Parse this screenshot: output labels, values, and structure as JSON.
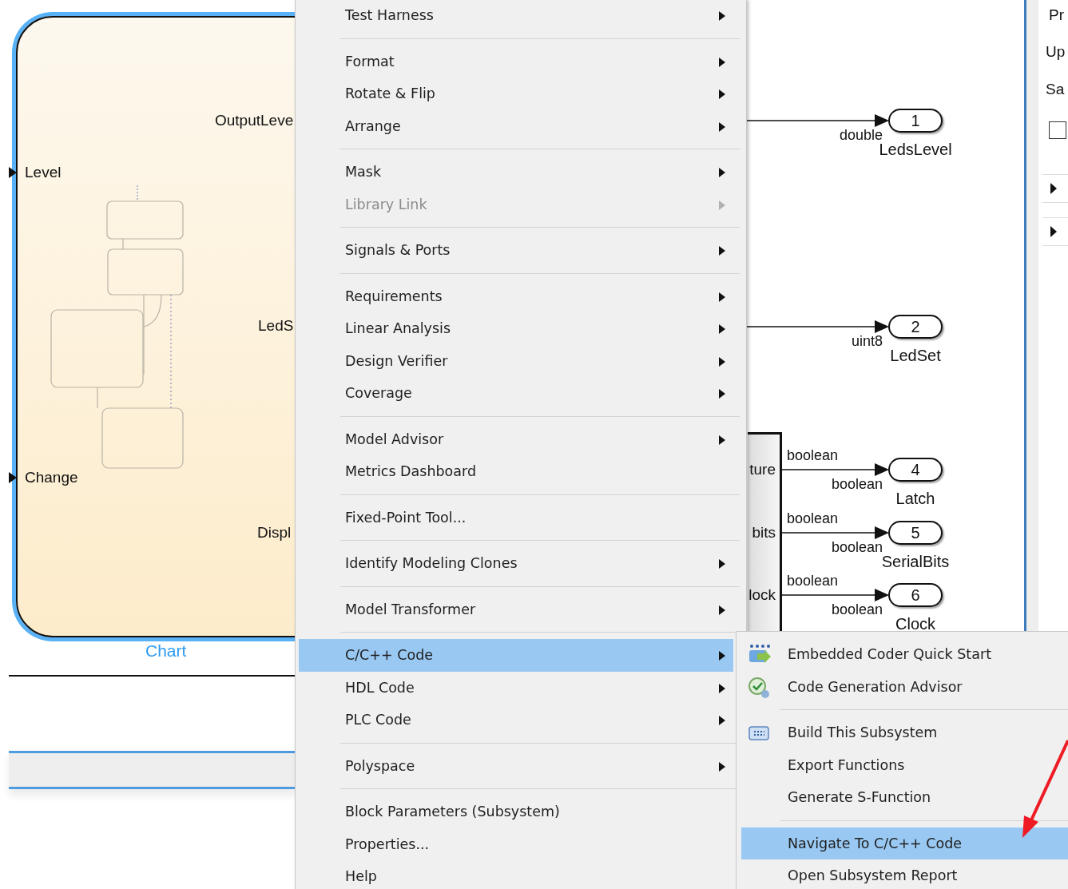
{
  "chart_block": {
    "title": "Chart",
    "inputs": [
      "Level",
      "Change"
    ],
    "outputs": [
      "OutputLeve",
      "LedS",
      "Displ"
    ]
  },
  "subsystem_block": {
    "ports": [
      "ture",
      "bits",
      "lock"
    ]
  },
  "outports": [
    {
      "number": "1",
      "name": "LedsLevel",
      "type_below": "double"
    },
    {
      "number": "2",
      "name": "LedSet",
      "type_below": "uint8"
    },
    {
      "number": "4",
      "name": "Latch",
      "type_above": "boolean",
      "type_below": "boolean"
    },
    {
      "number": "5",
      "name": "SerialBits",
      "type_above": "boolean",
      "type_below": "boolean"
    },
    {
      "number": "6",
      "name": "Clock",
      "type_above": "boolean",
      "type_below": "boolean"
    }
  ],
  "properties_panel": {
    "lines": [
      "Pr",
      "Up",
      "Sa"
    ],
    "checkbox": {
      "checked": false
    },
    "sections": [
      {
        "expanded": false
      },
      {
        "expanded": false
      }
    ]
  },
  "context_menu": {
    "items": [
      {
        "kind": "item",
        "label": "Test Harness",
        "submenu": true,
        "disabled": false,
        "selected": false
      },
      {
        "kind": "separator"
      },
      {
        "kind": "item",
        "label": "Format",
        "submenu": true,
        "disabled": false,
        "selected": false
      },
      {
        "kind": "item",
        "label": "Rotate & Flip",
        "submenu": true,
        "disabled": false,
        "selected": false
      },
      {
        "kind": "item",
        "label": "Arrange",
        "submenu": true,
        "disabled": false,
        "selected": false
      },
      {
        "kind": "separator"
      },
      {
        "kind": "item",
        "label": "Mask",
        "submenu": true,
        "disabled": false,
        "selected": false
      },
      {
        "kind": "item",
        "label": "Library Link",
        "submenu": true,
        "disabled": true,
        "selected": false
      },
      {
        "kind": "separator"
      },
      {
        "kind": "item",
        "label": "Signals & Ports",
        "submenu": true,
        "disabled": false,
        "selected": false
      },
      {
        "kind": "separator"
      },
      {
        "kind": "item",
        "label": "Requirements",
        "submenu": true,
        "disabled": false,
        "selected": false
      },
      {
        "kind": "item",
        "label": "Linear Analysis",
        "submenu": true,
        "disabled": false,
        "selected": false
      },
      {
        "kind": "item",
        "label": "Design Verifier",
        "submenu": true,
        "disabled": false,
        "selected": false
      },
      {
        "kind": "item",
        "label": "Coverage",
        "submenu": true,
        "disabled": false,
        "selected": false
      },
      {
        "kind": "separator"
      },
      {
        "kind": "item",
        "label": "Model Advisor",
        "submenu": true,
        "disabled": false,
        "selected": false
      },
      {
        "kind": "item",
        "label": "Metrics Dashboard",
        "submenu": false,
        "disabled": false,
        "selected": false
      },
      {
        "kind": "separator"
      },
      {
        "kind": "item",
        "label": "Fixed-Point Tool...",
        "submenu": false,
        "disabled": false,
        "selected": false
      },
      {
        "kind": "separator"
      },
      {
        "kind": "item",
        "label": "Identify Modeling Clones",
        "submenu": true,
        "disabled": false,
        "selected": false
      },
      {
        "kind": "separator"
      },
      {
        "kind": "item",
        "label": "Model Transformer",
        "submenu": true,
        "disabled": false,
        "selected": false
      },
      {
        "kind": "separator"
      },
      {
        "kind": "item",
        "label": "C/C++ Code",
        "submenu": true,
        "disabled": false,
        "selected": true
      },
      {
        "kind": "item",
        "label": "HDL Code",
        "submenu": true,
        "disabled": false,
        "selected": false
      },
      {
        "kind": "item",
        "label": "PLC Code",
        "submenu": true,
        "disabled": false,
        "selected": false
      },
      {
        "kind": "separator"
      },
      {
        "kind": "item",
        "label": "Polyspace",
        "submenu": true,
        "disabled": false,
        "selected": false
      },
      {
        "kind": "separator"
      },
      {
        "kind": "item",
        "label": "Block Parameters (Subsystem)",
        "submenu": false,
        "disabled": false,
        "selected": false
      },
      {
        "kind": "item",
        "label": "Properties...",
        "submenu": false,
        "disabled": false,
        "selected": false
      },
      {
        "kind": "item",
        "label": "Help",
        "submenu": false,
        "disabled": false,
        "selected": false
      }
    ]
  },
  "submenu": {
    "items": [
      {
        "kind": "item",
        "label": "Embedded Coder Quick Start",
        "selected": false
      },
      {
        "kind": "item",
        "label": "Code Generation Advisor",
        "selected": false
      },
      {
        "kind": "separator"
      },
      {
        "kind": "item",
        "label": "Build This Subsystem",
        "selected": false
      },
      {
        "kind": "item",
        "label": "Export Functions",
        "selected": false
      },
      {
        "kind": "item",
        "label": "Generate S-Function",
        "selected": false
      },
      {
        "kind": "separator"
      },
      {
        "kind": "item",
        "label": "Navigate To C/C++ Code",
        "selected": true
      },
      {
        "kind": "item",
        "label": "Open Subsystem Report",
        "selected": false
      }
    ]
  }
}
